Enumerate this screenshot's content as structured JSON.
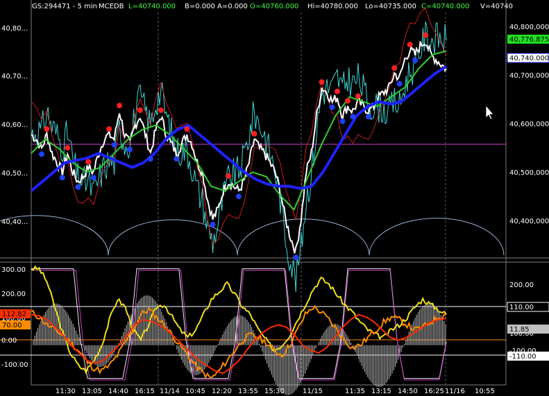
{
  "header": {
    "symbol": "GS:294471 - 5 min",
    "study": "MCEDB",
    "last": "L=40740.000",
    "bid": "B=0.000",
    "ask": "A=0.000",
    "open": "O=40760.000",
    "high": "Hi=40780.000",
    "low": "Lo=40735.000",
    "close": "C=40740.000",
    "volume": "V=40740"
  },
  "colors": {
    "background": "#000000",
    "price_line": "#ffffff",
    "cyan_line": "#40d8d8",
    "red_line": "#c81e1e",
    "green_line": "#30d030",
    "blue_line": "#1e22ff",
    "magenta_line": "#d040d0",
    "arc_line": "#9ab4d8",
    "osc_yellow": "#f0e020",
    "osc_orange": "#ff8c00",
    "osc_red": "#ff2a00",
    "osc_white": "#f0f0f0",
    "osc_gray": "#c0c0c0",
    "dot_red": "#ff2020",
    "dot_blue": "#2040ff"
  },
  "price_panel": {
    "left_ticks": [
      "40,80...",
      "40,70...",
      "40,60...",
      "40,50...",
      "40,40..."
    ],
    "right_ticks": [
      "40,800,000",
      "40,700,000",
      "40,600,000",
      "40,500,000",
      "40,400,000"
    ],
    "green_badge": "40,776.875",
    "white_badge": "40,740.000"
  },
  "osc_panel": {
    "left_ticks": [
      "300.00",
      "200.00",
      "100.00",
      "0.00",
      "-100.00"
    ],
    "right_ticks": [
      "200.00",
      "100.00",
      "-100.00"
    ],
    "red_badge": "112.82",
    "orange_badge": "70.00",
    "white_badge_110": "110.00",
    "gray_badge": "11.85",
    "white_badge_m110": "-110.00"
  },
  "time_axis": {
    "labels": [
      "11:30",
      "13:05",
      "14:40",
      "16:15",
      "11/14",
      "10:45",
      "12:20",
      "13:55",
      "15:30",
      "11/15",
      "11:35",
      "13:15",
      "14:50",
      "16:25",
      "11/16",
      "10:55"
    ]
  },
  "chart_data": {
    "type": "line",
    "price_range": [
      40340,
      40860
    ],
    "osc_range": [
      -150,
      320
    ],
    "price_series": [
      40600,
      40590,
      40570,
      40600,
      40560,
      40540,
      40520,
      40560,
      40520,
      40500,
      40510,
      40530,
      40520,
      40560,
      40590,
      40600,
      40590,
      40650,
      40600,
      40580,
      40620,
      40640,
      40600,
      40560,
      40610,
      40640,
      40600,
      40580,
      40560,
      40580,
      40600,
      40580,
      40540,
      40520,
      40460,
      40420,
      40440,
      40480,
      40500,
      40490,
      40480,
      40500,
      40540,
      40590,
      40570,
      40560,
      40540,
      40520,
      40480,
      40420,
      40380,
      40350,
      40420,
      40520,
      40560,
      40640,
      40700,
      40690,
      40670,
      40680,
      40640,
      40660,
      40650,
      40670,
      40660,
      40650,
      40660,
      40680,
      40690,
      40700,
      40730,
      40720,
      40760,
      40780,
      40770,
      40790,
      40800,
      40770,
      40760,
      40750,
      40740
    ],
    "slow_ma": [
      40480,
      40500,
      40520,
      40540,
      40545,
      40550,
      40560,
      40550,
      40540,
      40530,
      40540,
      40560,
      40590,
      40610,
      40620,
      40600,
      40580,
      40560,
      40540,
      40520,
      40505,
      40495,
      40490,
      40490,
      40485,
      40490,
      40520,
      40560,
      40600,
      40640,
      40660,
      40670,
      40665,
      40670,
      40690,
      40710,
      40730,
      40745
    ],
    "fast_ma": [
      40560,
      40590,
      40570,
      40540,
      40520,
      40530,
      40560,
      40590,
      40610,
      40620,
      40600,
      40570,
      40540,
      40490,
      40480,
      40500,
      40520,
      40510,
      40470,
      40440,
      40510,
      40580,
      40640,
      40680,
      40670,
      40660,
      40680,
      40700,
      40740,
      40770,
      40778
    ],
    "osc_yellow": [
      300,
      300,
      250,
      150,
      50,
      -30,
      -80,
      -100,
      -60,
      0,
      100,
      180,
      150,
      60,
      20,
      80,
      150,
      160,
      110,
      60,
      30,
      60,
      120,
      180,
      210,
      240,
      200,
      150,
      120,
      60,
      20,
      -20,
      0,
      40,
      100,
      160,
      220,
      260,
      240,
      200,
      160,
      130,
      90,
      60,
      40,
      30,
      60,
      80,
      110,
      150,
      180,
      160,
      140,
      120
    ],
    "osc_orange": [
      130,
      110,
      80,
      60,
      40,
      10,
      -20,
      -60,
      -90,
      -100,
      -80,
      -40,
      10,
      60,
      120,
      140,
      110,
      80,
      40,
      0,
      -40,
      -80,
      -110,
      -130,
      -100,
      -60,
      -20,
      20,
      40,
      30,
      10,
      -20,
      -40,
      0,
      60,
      120,
      150,
      130,
      100,
      60,
      20,
      -10,
      0,
      30,
      60,
      90,
      110,
      100,
      80,
      60,
      70,
      90,
      110,
      120
    ],
    "osc_red": [
      120,
      115,
      100,
      70,
      40,
      0,
      -30,
      -60,
      -70,
      -60,
      -30,
      0,
      40,
      80,
      100,
      95,
      80,
      60,
      30,
      0,
      -30,
      -60,
      -80,
      -100,
      -110,
      -90,
      -60,
      -20,
      20,
      50,
      70,
      80,
      70,
      40,
      0,
      -20,
      -30,
      -10,
      30,
      70,
      100,
      120,
      110,
      90,
      60,
      30,
      20,
      30,
      50,
      70,
      90,
      100,
      105
    ]
  }
}
